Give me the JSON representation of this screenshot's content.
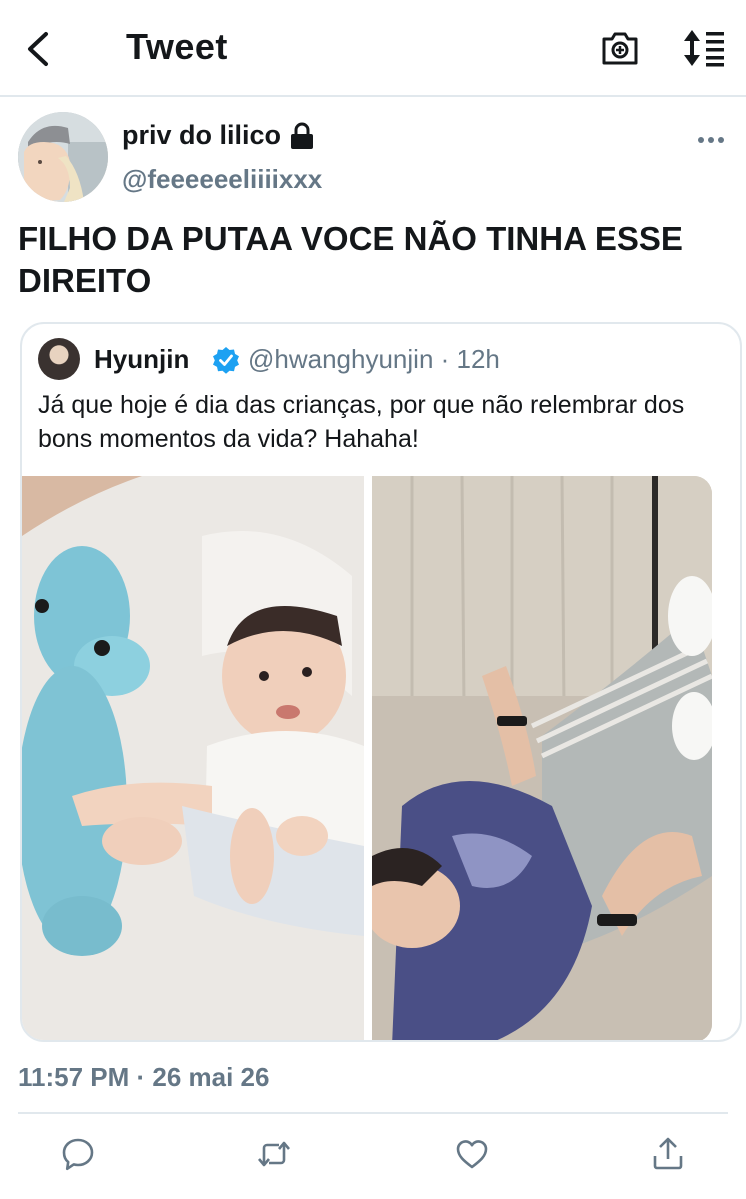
{
  "header": {
    "title": "Tweet"
  },
  "tweet": {
    "display_name": "priv do lilico",
    "handle": "@feeeeeeliiiixxx",
    "text": "FILHO DA PUTAA VOCE NÃO TINHA ESSE DIREITO",
    "timestamp": "11:57 PM · 26 mai 26"
  },
  "quote": {
    "name": "Hyunjin",
    "handle_time": "@hwanghyunjin · 12h",
    "text": "Já que hoje é dia das crianças, por que não relembrar dos bons momentos da vida? Hahaha!"
  },
  "icons": {
    "back": "chevron-left-icon",
    "camera": "camera-add-icon",
    "sort": "sort-icon",
    "lock": "lock-icon",
    "more": "more-icon",
    "verified": "verified-icon",
    "reply": "reply-icon",
    "retweet": "retweet-icon",
    "like": "heart-icon",
    "share": "share-icon"
  },
  "colors": {
    "text": "#14171a",
    "secondary": "#657786",
    "verified": "#1da1f2",
    "border": "#e1e8ed"
  }
}
